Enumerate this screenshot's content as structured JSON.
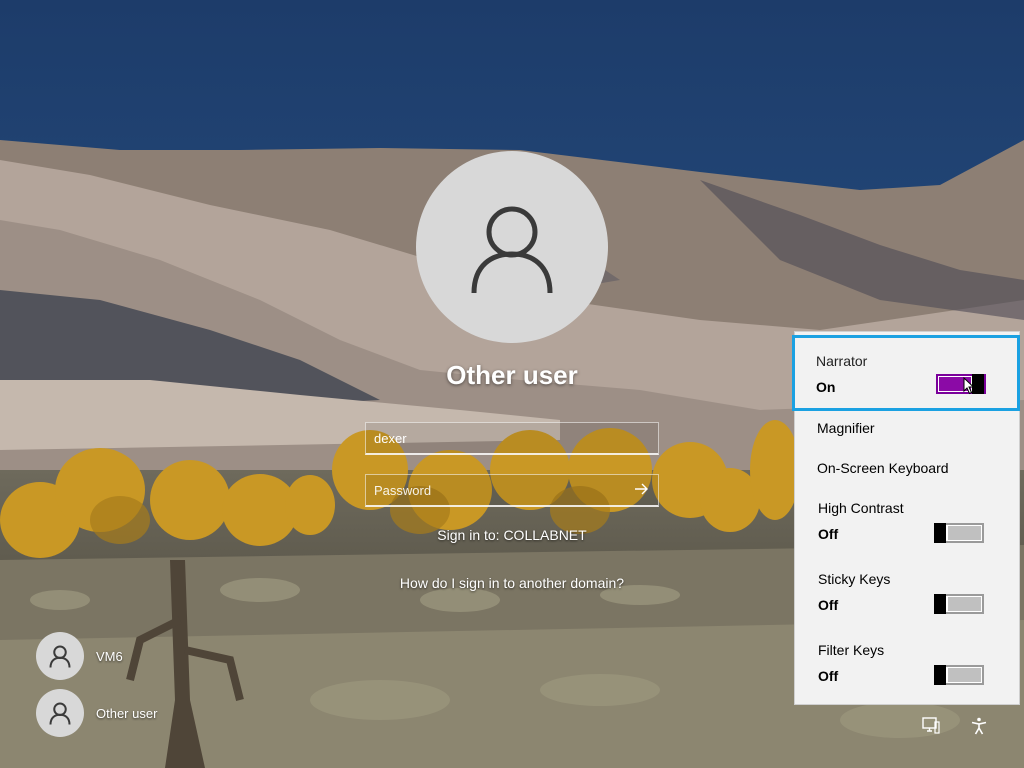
{
  "login": {
    "display_name": "Other user",
    "username_value": "dexer",
    "password_placeholder": "Password",
    "sign_in_to": "Sign in to: COLLABNET",
    "other_domain_link": "How do I sign in to another domain?"
  },
  "users": [
    {
      "name": "VM6"
    },
    {
      "name": "Other user"
    }
  ],
  "ease_of_access": {
    "narrator": {
      "label": "Narrator",
      "state": "On"
    },
    "magnifier": {
      "label": "Magnifier"
    },
    "onscreen_keyboard": {
      "label": "On-Screen Keyboard"
    },
    "high_contrast": {
      "label": "High Contrast",
      "state": "Off"
    },
    "sticky_keys": {
      "label": "Sticky Keys",
      "state": "Off"
    },
    "filter_keys": {
      "label": "Filter Keys",
      "state": "Off"
    }
  },
  "icons": {
    "submit": "arrow-right-icon",
    "network": "network-icon",
    "ease_of_access": "ease-of-access-icon"
  },
  "colors": {
    "focus_outline": "#1ba1e2",
    "toggle_on": "#8b0aa6",
    "flyout_bg": "#f2f2f2"
  }
}
